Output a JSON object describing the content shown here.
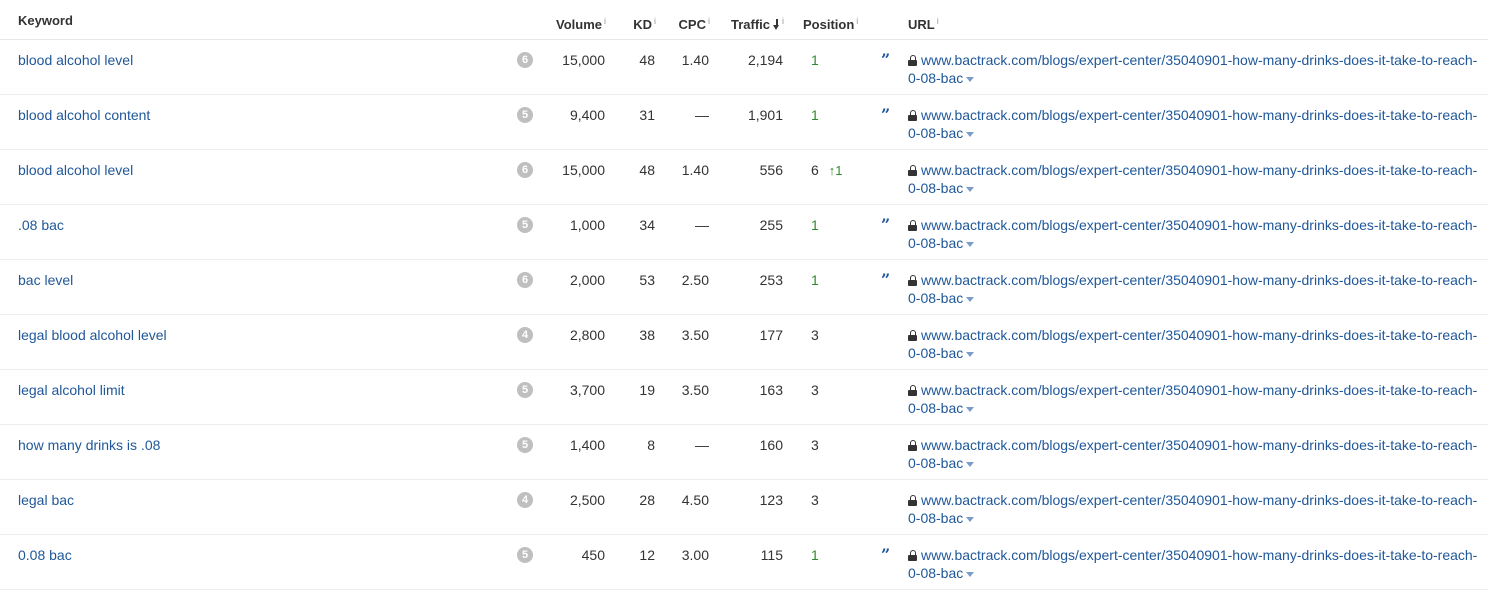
{
  "header": {
    "keyword": "Keyword",
    "volume": "Volume",
    "kd": "KD",
    "cpc": "CPC",
    "traffic": "Traffic",
    "position": "Position",
    "url": "URL",
    "info_glyph": "i"
  },
  "url_parts": {
    "line1": "www.bactrack.com/blogs/expert-center/35040901-how-many-drinks-does-it-take-to-reach-",
    "line2": "0-08-bac"
  },
  "colors": {
    "link": "#1f5799",
    "position_green": "#2e8a2e",
    "badge": "#bfbfbf"
  },
  "rows": [
    {
      "keyword": "blood alcohol level",
      "serp_features": "6",
      "volume": "15,000",
      "kd": "48",
      "cpc": "1.40",
      "traffic": "2,194",
      "position": "1",
      "position_change": "",
      "featured_snippet": true
    },
    {
      "keyword": "blood alcohol content",
      "serp_features": "5",
      "volume": "9,400",
      "kd": "31",
      "cpc": "—",
      "traffic": "1,901",
      "position": "1",
      "position_change": "",
      "featured_snippet": true
    },
    {
      "keyword": "blood alcohol level",
      "serp_features": "6",
      "volume": "15,000",
      "kd": "48",
      "cpc": "1.40",
      "traffic": "556",
      "position": "6",
      "position_change": "↑1",
      "featured_snippet": false
    },
    {
      "keyword": ".08 bac",
      "serp_features": "5",
      "volume": "1,000",
      "kd": "34",
      "cpc": "—",
      "traffic": "255",
      "position": "1",
      "position_change": "",
      "featured_snippet": true
    },
    {
      "keyword": "bac level",
      "serp_features": "6",
      "volume": "2,000",
      "kd": "53",
      "cpc": "2.50",
      "traffic": "253",
      "position": "1",
      "position_change": "",
      "featured_snippet": true
    },
    {
      "keyword": "legal blood alcohol level",
      "serp_features": "4",
      "volume": "2,800",
      "kd": "38",
      "cpc": "3.50",
      "traffic": "177",
      "position": "3",
      "position_change": "",
      "featured_snippet": false
    },
    {
      "keyword": "legal alcohol limit",
      "serp_features": "5",
      "volume": "3,700",
      "kd": "19",
      "cpc": "3.50",
      "traffic": "163",
      "position": "3",
      "position_change": "",
      "featured_snippet": false
    },
    {
      "keyword": "how many drinks is .08",
      "serp_features": "5",
      "volume": "1,400",
      "kd": "8",
      "cpc": "—",
      "traffic": "160",
      "position": "3",
      "position_change": "",
      "featured_snippet": false
    },
    {
      "keyword": "legal bac",
      "serp_features": "4",
      "volume": "2,500",
      "kd": "28",
      "cpc": "4.50",
      "traffic": "123",
      "position": "3",
      "position_change": "",
      "featured_snippet": false
    },
    {
      "keyword": "0.08 bac",
      "serp_features": "5",
      "volume": "450",
      "kd": "12",
      "cpc": "3.00",
      "traffic": "115",
      "position": "1",
      "position_change": "",
      "featured_snippet": true
    }
  ]
}
